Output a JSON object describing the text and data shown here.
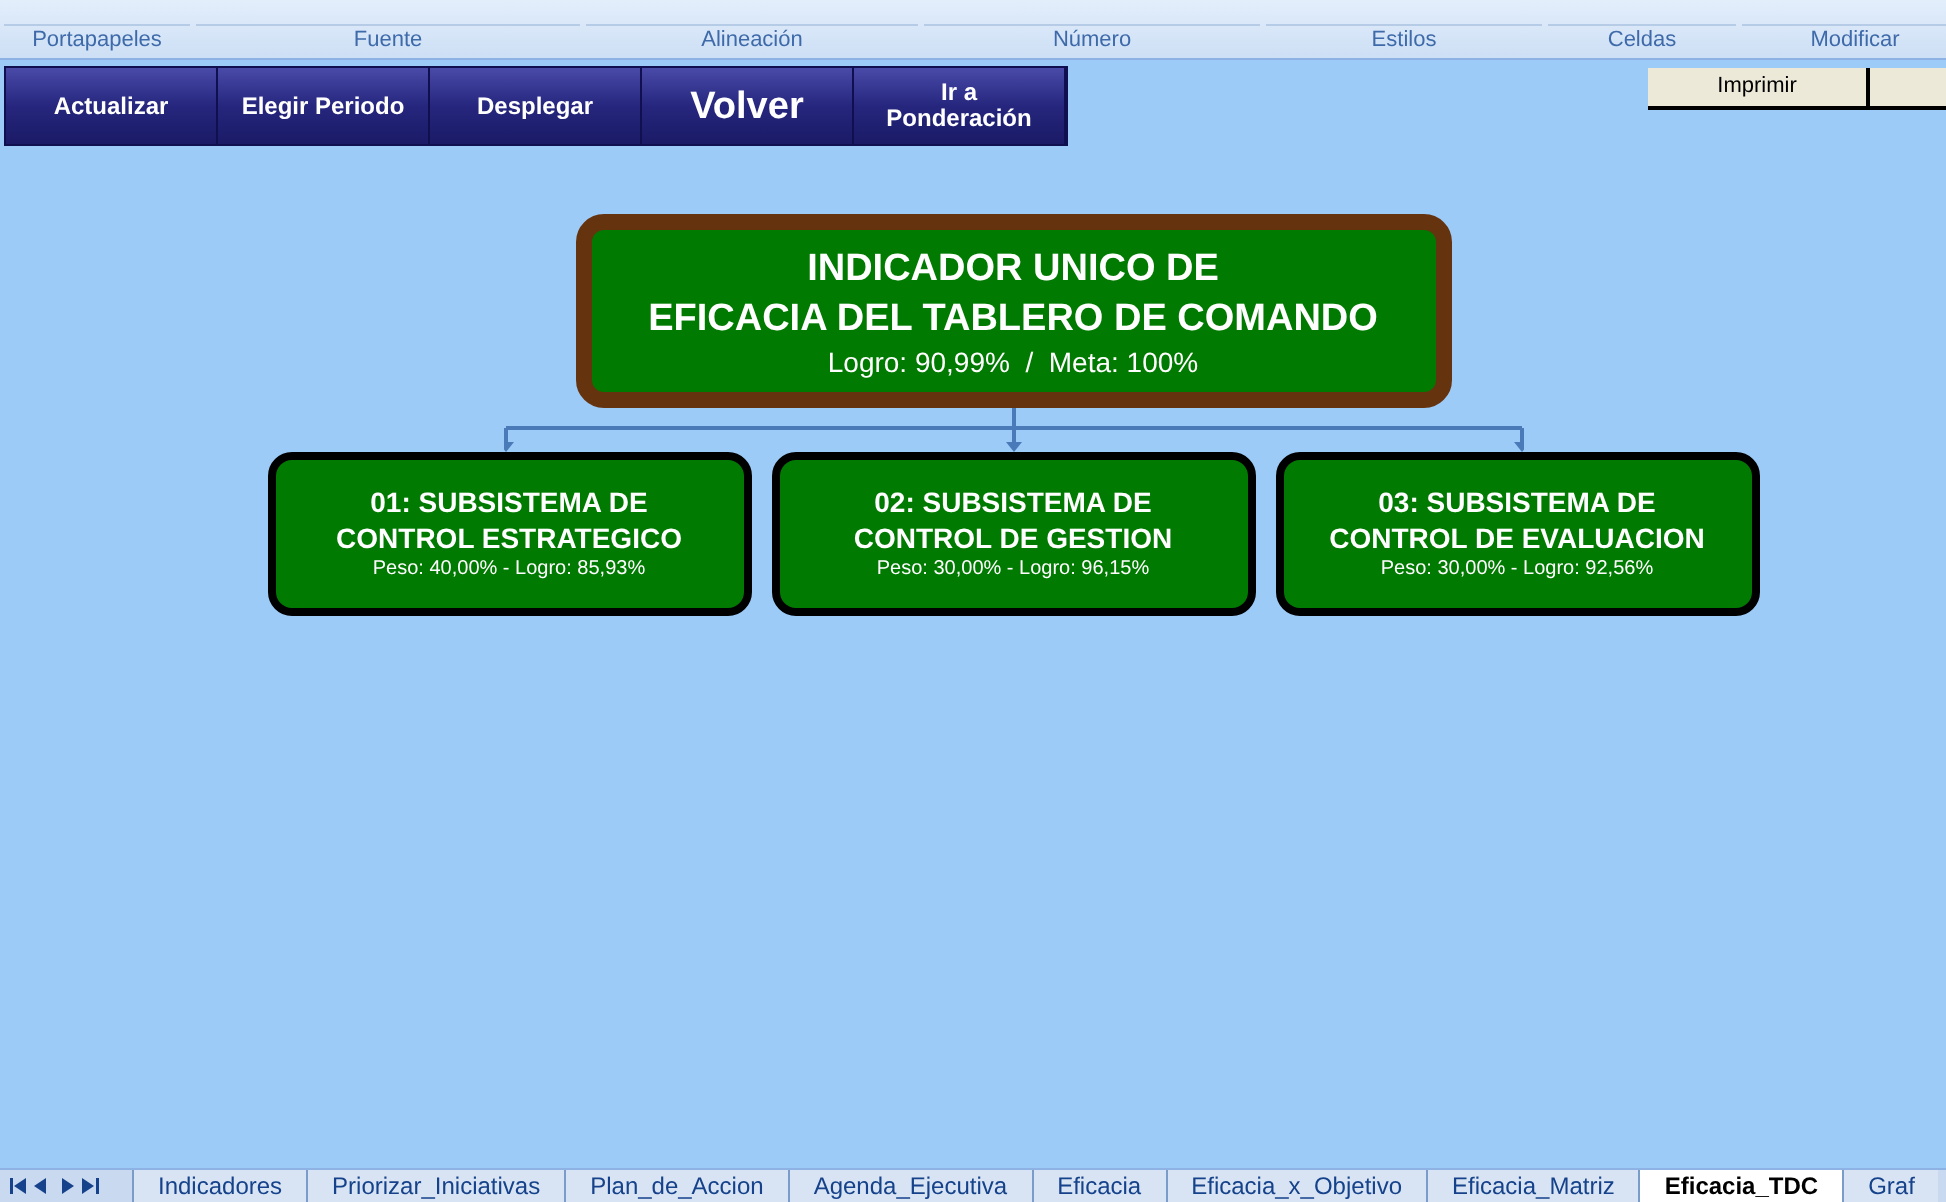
{
  "ribbon_groups": [
    "Portapapeles",
    "Fuente",
    "Alineación",
    "Número",
    "Estilos",
    "Celdas",
    "Modificar"
  ],
  "toolbar": [
    {
      "label": "Actualizar",
      "kind": "normal"
    },
    {
      "label": "Elegir Periodo",
      "kind": "normal"
    },
    {
      "label": "Desplegar",
      "kind": "normal"
    },
    {
      "label": "Volver",
      "kind": "large"
    },
    {
      "label": "Ir a Ponderación",
      "kind": "normal"
    }
  ],
  "print_button": "Imprimir",
  "main_indicator": {
    "title_lines": [
      "INDICADOR UNICO DE",
      "EFICACIA DEL TABLERO DE COMANDO"
    ],
    "detail": "Logro: 90,99%  /  Meta: 100%"
  },
  "subsystems": [
    {
      "title_lines": [
        "01: SUBSISTEMA DE",
        "CONTROL ESTRATEGICO"
      ],
      "detail": "Peso: 40,00% - Logro: 85,93%"
    },
    {
      "title_lines": [
        "02: SUBSISTEMA DE",
        "CONTROL DE GESTION"
      ],
      "detail": "Peso: 30,00% - Logro: 96,15%"
    },
    {
      "title_lines": [
        "03: SUBSISTEMA DE",
        "CONTROL DE EVALUACION"
      ],
      "detail": "Peso: 30,00% - Logro: 92,56%"
    }
  ],
  "sheet_tabs": [
    {
      "label": "Indicadores",
      "selected": false
    },
    {
      "label": "Priorizar_Iniciativas",
      "selected": false
    },
    {
      "label": "Plan_de_Accion",
      "selected": false
    },
    {
      "label": "Agenda_Ejecutiva",
      "selected": false
    },
    {
      "label": "Eficacia",
      "selected": false
    },
    {
      "label": "Eficacia_x_Objetivo",
      "selected": false
    },
    {
      "label": "Eficacia_Matriz",
      "selected": false
    },
    {
      "label": "Eficacia_TDC",
      "selected": true
    },
    {
      "label": "Graf",
      "selected": false
    }
  ]
}
